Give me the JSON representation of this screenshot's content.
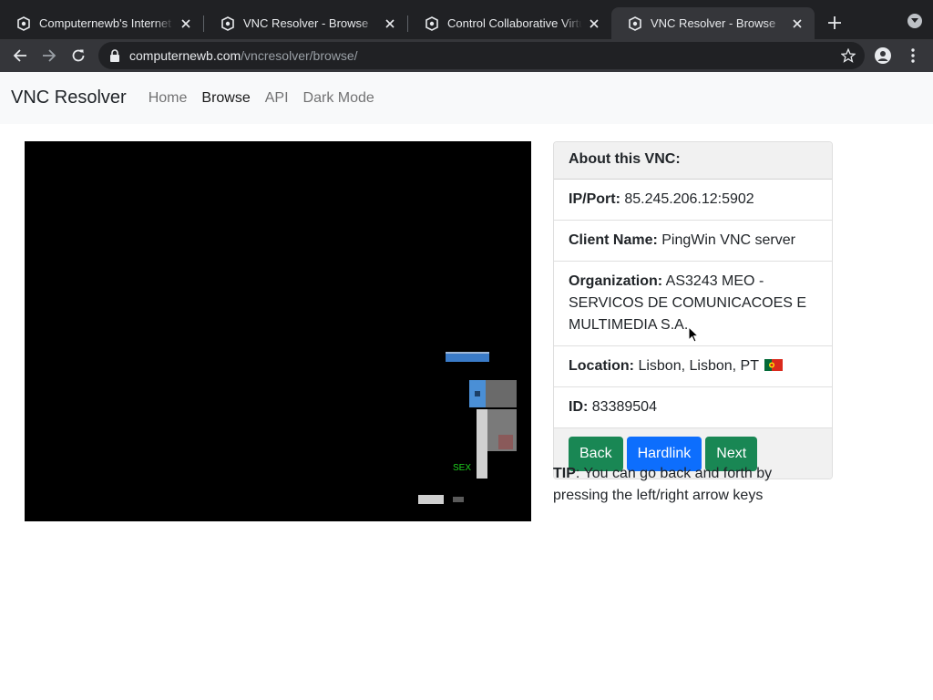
{
  "browser": {
    "tabs": [
      {
        "title": "Computernewb's Internet Pi",
        "active": false
      },
      {
        "title": "VNC Resolver - Browse",
        "active": false
      },
      {
        "title": "Control Collaborative Virtua",
        "active": false
      },
      {
        "title": "VNC Resolver - Browse",
        "active": true
      }
    ],
    "url_host": "computernewb.com",
    "url_path": "/vncresolver/browse/"
  },
  "nav": {
    "brand": "VNC Resolver",
    "links": [
      {
        "label": "Home",
        "active": false
      },
      {
        "label": "Browse",
        "active": true
      },
      {
        "label": "API",
        "active": false
      },
      {
        "label": "Dark Mode",
        "active": false
      }
    ]
  },
  "screenshot": {
    "label_text": "SEX",
    "label_color": "#1fd11f"
  },
  "about": {
    "header": "About this VNC:",
    "ip_label": "IP/Port:",
    "ip_value": "85.245.206.12:5902",
    "client_label": "Client Name:",
    "client_value": "PingWin VNC server",
    "org_label": "Organization:",
    "org_value": "AS3243 MEO - SERVICOS DE COMUNICACOES E MULTIMEDIA S.A.",
    "location_label": "Location:",
    "location_value": "Lisbon, Lisbon, PT",
    "id_label": "ID:",
    "id_value": "83389504"
  },
  "buttons": {
    "back": "Back",
    "hardlink": "Hardlink",
    "next": "Next"
  },
  "tip": {
    "label": "TIP",
    "text": ": You can go back and forth by pressing the left/right arrow keys"
  },
  "colors": {
    "success": "#198754",
    "primary": "#0d6efd",
    "chrome_dark": "#202124",
    "chrome_mid": "#35363a"
  }
}
